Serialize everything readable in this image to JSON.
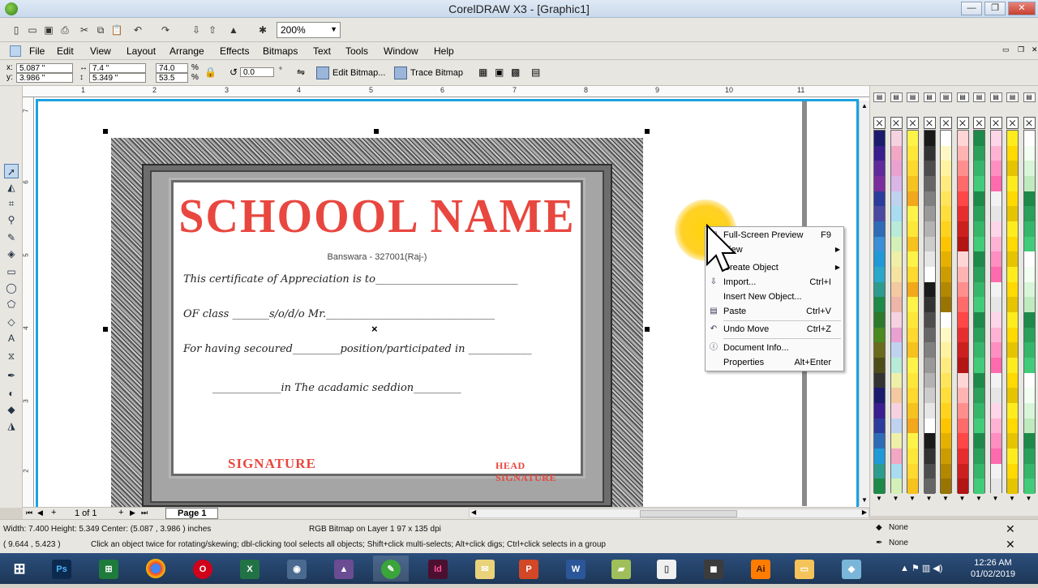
{
  "window": {
    "title": "CorelDRAW X3 - [Graphic1]",
    "minimize": "—",
    "restore": "❐",
    "close": "✕"
  },
  "toolbar": {
    "zoom": "200%"
  },
  "menu": [
    "File",
    "Edit",
    "View",
    "Layout",
    "Arrange",
    "Effects",
    "Bitmaps",
    "Text",
    "Tools",
    "Window",
    "Help"
  ],
  "property_bar": {
    "x": "5.087 \"",
    "y": "3.986 \"",
    "width": "7.4 \"",
    "height": "5.349 \"",
    "scale_w": "74.0",
    "scale_h": "53.5",
    "pct": "%",
    "angle": "0.0",
    "deg": "°",
    "x_label": "x:",
    "y_label": "y:",
    "edit_bitmap": "Edit Bitmap...",
    "trace_bitmap": "Trace Bitmap"
  },
  "ruler": {
    "units": "inches",
    "top": [
      "1",
      "2",
      "3",
      "4",
      "5",
      "6",
      "7",
      "8",
      "9",
      "10",
      "11"
    ],
    "left": [
      "7",
      "6",
      "5",
      "4",
      "3",
      "2"
    ]
  },
  "certificate": {
    "school_name": "SCHOOOL NAME",
    "address": "Banswara - 327001(Raj-)",
    "line1": "This certificate of Appreciation is to___________________________",
    "line2": "OF class _______s/o/d/o Mr.________________________________",
    "line3": "For having secoured_________position/participated in ____________",
    "line4": "_____________in The acadamic seddion_________",
    "signature": "SIGNATURE",
    "head_signature": "HEAD SIGNATURE",
    "center_mark": "×"
  },
  "context_menu": [
    {
      "label": "Full-Screen Preview",
      "shortcut": "F9",
      "icon": "preview-icon"
    },
    {
      "label": "View",
      "submenu": true
    },
    {
      "label": "Create Object",
      "submenu": true
    },
    {
      "label": "Import...",
      "shortcut": "Ctrl+I",
      "icon": "import-icon"
    },
    {
      "label": "Insert New Object...",
      "shortcut": ""
    },
    {
      "label": "Paste",
      "shortcut": "Ctrl+V",
      "icon": "paste-icon"
    },
    {
      "label": "Undo Move",
      "shortcut": "Ctrl+Z",
      "icon": "undo-icon"
    },
    {
      "label": "Document Info...",
      "icon": "info-icon"
    },
    {
      "label": "Properties",
      "shortcut": "Alt+Enter"
    }
  ],
  "page_nav": {
    "count": "1 of 1",
    "tab": "Page 1"
  },
  "status": {
    "dimensions": "Width: 7.400  Height: 5.349   Center: (5.087 , 3.986 )  inches",
    "object_info": "RGB Bitmap on Layer 1 97 x 135 dpi",
    "cursor": "( 9.644 , 5.423 )",
    "hint": "Click an object twice for rotating/skewing; dbl-clicking tool selects all objects; Shift+click multi-selects; Alt+click digs; Ctrl+click selects in a group",
    "fill": "None",
    "outline": "None"
  },
  "taskbar": {
    "apps": [
      "Ps",
      "Excel",
      "Chrome",
      "Opera",
      "X",
      "Camera",
      "Corel",
      "Corel",
      "Id",
      "App",
      "P",
      "W",
      "App",
      "File",
      "App",
      "Ai",
      "Folder",
      "App"
    ],
    "time": "12:26 AM",
    "date": "01/02/2019"
  },
  "palette_colors": [
    [
      "#1b1b6e",
      "#3a1d8f",
      "#5e2a9c",
      "#7a2e9e",
      "#2c3c9c",
      "#4a4aa3",
      "#2e6cb8",
      "#3a8fd6",
      "#1f9ad6",
      "#2aa7c9",
      "#2d9c8e",
      "#1e8a4a",
      "#2d7a2d",
      "#4a8a1e",
      "#6b6b1e",
      "#4d4d1a",
      "#333333",
      "#1b1b6e",
      "#3a1d8f",
      "#2c3c9c",
      "#2e6cb8",
      "#1f9ad6",
      "#2d9c8e",
      "#1e8a4a"
    ],
    [
      "#f6d2e0",
      "#f2a8c4",
      "#e9a1d1",
      "#d9b5e8",
      "#bfd3f0",
      "#a9dcf0",
      "#b8ecd8",
      "#d4f0b8",
      "#eef0a9",
      "#f4e3a1",
      "#f2c9a1",
      "#eeb5a9",
      "#f6d2e0",
      "#e9a1d1",
      "#bfd3f0",
      "#b8ecd8",
      "#eef0a9",
      "#f2c9a1",
      "#f6d2e0",
      "#bfd3f0",
      "#eef0a9",
      "#f2a8c4",
      "#a9dcf0",
      "#d4f0b8"
    ],
    [
      "#fff34a",
      "#ffe73a",
      "#ffd92e",
      "#f6c21e",
      "#f2a81a",
      "#fff34a",
      "#ffe73a",
      "#f6c21e",
      "#fff34a",
      "#ffd92e",
      "#f2a81a",
      "#fff34a",
      "#ffe73a",
      "#ffd92e",
      "#f6c21e",
      "#fff34a",
      "#ffe73a",
      "#ffd92e",
      "#f6c21e",
      "#f2a81a",
      "#fff34a",
      "#ffe73a",
      "#ffd92e",
      "#f6c21e"
    ],
    [
      "#1a1a1a",
      "#333",
      "#4d4d4d",
      "#666",
      "#808080",
      "#999",
      "#b3b3b3",
      "#ccc",
      "#e6e6e6",
      "#fff",
      "#1a1a1a",
      "#333",
      "#4d4d4d",
      "#666",
      "#808080",
      "#999",
      "#b3b3b3",
      "#ccc",
      "#e6e6e6",
      "#fff",
      "#1a1a1a",
      "#333",
      "#4d4d4d",
      "#666"
    ],
    [
      "#fff",
      "#fff8c4",
      "#fff2a0",
      "#ffeb80",
      "#ffe45c",
      "#ffdd3a",
      "#ffd21e",
      "#ffc400",
      "#e6b000",
      "#cc9c00",
      "#b38800",
      "#997400",
      "#fff",
      "#fff8c4",
      "#fff2a0",
      "#ffeb80",
      "#ffe45c",
      "#ffdd3a",
      "#ffd21e",
      "#ffc400",
      "#e6b000",
      "#cc9c00",
      "#b38800",
      "#997400"
    ],
    [
      "#ffd5d5",
      "#ffb3b3",
      "#ff8f8f",
      "#ff6b6b",
      "#ff4747",
      "#e62e2e",
      "#cc1f1f",
      "#b31414",
      "#ffd5d5",
      "#ffb3b3",
      "#ff8f8f",
      "#ff6b6b",
      "#ff4747",
      "#e62e2e",
      "#cc1f1f",
      "#b31414",
      "#ffd5d5",
      "#ffb3b3",
      "#ff8f8f",
      "#ff6b6b",
      "#ff4747",
      "#e62e2e",
      "#cc1f1f",
      "#b31414"
    ],
    [
      "#1e8a4a",
      "#2aa05a",
      "#36b66a",
      "#42cc7a",
      "#1e8a4a",
      "#2aa05a",
      "#36b66a",
      "#42cc7a",
      "#1e8a4a",
      "#2aa05a",
      "#36b66a",
      "#42cc7a",
      "#1e8a4a",
      "#2aa05a",
      "#36b66a",
      "#42cc7a",
      "#1e8a4a",
      "#2aa05a",
      "#36b66a",
      "#42cc7a",
      "#1e8a4a",
      "#2aa05a",
      "#36b66a",
      "#42cc7a"
    ],
    [
      "#ffd5e8",
      "#ffb3d4",
      "#ff8fc0",
      "#ff6bac",
      "#f2f2f2",
      "#e6e6e6",
      "#ffd5e8",
      "#ffb3d4",
      "#ff8fc0",
      "#ff6bac",
      "#f2f2f2",
      "#e6e6e6",
      "#ffd5e8",
      "#ffb3d4",
      "#ff8fc0",
      "#ff6bac",
      "#f2f2f2",
      "#e6e6e6",
      "#ffd5e8",
      "#ffb3d4",
      "#ff8fc0",
      "#ff6bac",
      "#f2f2f2",
      "#e6e6e6"
    ],
    [
      "#ffec1f",
      "#ffd900",
      "#e6c400",
      "#ffec1f",
      "#ffd900",
      "#e6c400",
      "#ffec1f",
      "#ffd900",
      "#e6c400",
      "#ffec1f",
      "#ffd900",
      "#e6c400",
      "#ffec1f",
      "#ffd900",
      "#e6c400",
      "#ffec1f",
      "#ffd900",
      "#e6c400",
      "#ffec1f",
      "#ffd900",
      "#e6c400",
      "#ffec1f",
      "#ffd900",
      "#e6c400"
    ],
    [
      "#ffffff",
      "#f2fff2",
      "#d9f5d9",
      "#bfeabf",
      "#1e8a4a",
      "#2aa05a",
      "#36b66a",
      "#42cc7a",
      "#ffffff",
      "#f2fff2",
      "#d9f5d9",
      "#bfeabf",
      "#1e8a4a",
      "#2aa05a",
      "#36b66a",
      "#42cc7a",
      "#ffffff",
      "#f2fff2",
      "#d9f5d9",
      "#bfeabf",
      "#1e8a4a",
      "#2aa05a",
      "#36b66a",
      "#42cc7a"
    ]
  ]
}
